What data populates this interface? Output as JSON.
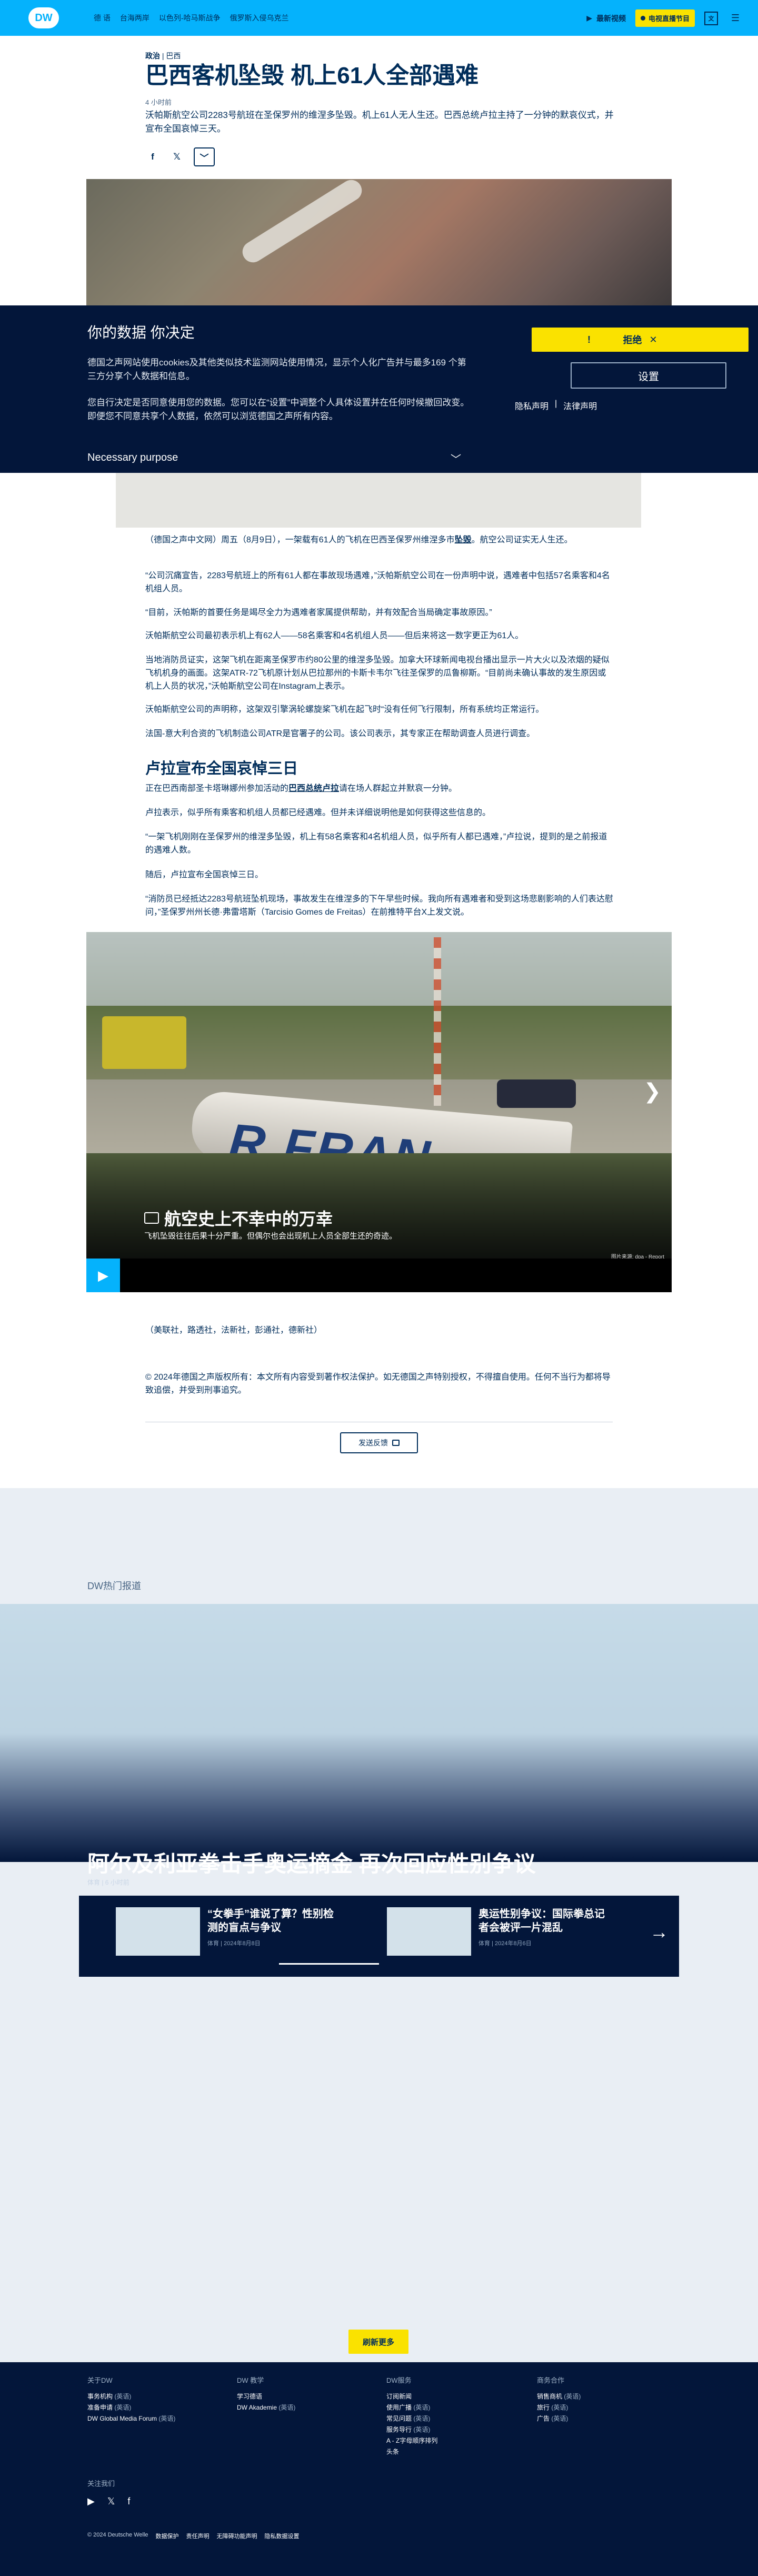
{
  "header": {
    "logo_text": "DW",
    "nav": [
      "德 语",
      "台海两岸",
      "以色列-哈马斯战争",
      "俄罗斯入侵乌克兰"
    ],
    "latest_label": "最新视频",
    "live_label": "电视直播节目",
    "lang_label": "文"
  },
  "article": {
    "kicker_section": "政治",
    "kicker_place": "巴西",
    "title": "巴西客机坠毁 机上61人全部遇难",
    "timestamp": "4 小时前",
    "lead": "沃帕斯航空公司2283号航班在圣保罗州的维涅多坠毁。机上61人无人生还。巴西总统卢拉主持了一分钟的默哀仪式，并宣布全国哀悼三天。",
    "paragraphs": [
      "（德国之声中文网）周五（8月9日），一架载有61人的飞机在巴西圣保罗州维涅多市坠毁。航空公司证实无人生还。",
      "“公司沉痛宣告，2283号航班上的所有61人都在事故现场遇难，”沃帕斯航空公司在一份声明中说，遇难者中包括57名乘客和4名机组人员。",
      "“目前，沃帕斯的首要任务是竭尽全力为遇难者家属提供帮助，并有效配合当局确定事故原因。”",
      "沃帕斯航空公司最初表示机上有62人——58名乘客和4名机组人员——但后来将这一数字更正为61人。",
      "当地消防员证实，这架飞机在距离圣保罗市约80公里的维涅多坠毁。加拿大环球新闻电视台播出显示一片大火以及浓烟的疑似飞机机身的画面。这架ATR-72飞机原计划从巴拉那州的卡斯卡韦尔飞往圣保罗的瓜鲁柳斯。“目前尚未确认事故的发生原因或机上人员的状况，”沃帕斯航空公司在Instagram上表示。",
      "沃帕斯航空公司的声明称，这架双引擎涡轮螺旋桨飞机在起飞时“没有任何飞行限制，所有系统均正常运行。",
      "法国-意大利合资的飞机制造公司ATR是官署子的公司。该公司表示，其专家正在帮助调查人员进行调查。",
      "正在巴西南部圣卡塔琳娜州参加活动的巴西总统卢拉请在场人群起立并默哀一分钟。",
      "卢拉表示，似乎所有乘客和机组人员都已经遇难。但并未详细说明他是如何获得这些信息的。",
      "“一架飞机刚刚在圣保罗州的维涅多坠毁，机上有58名乘客和4名机组人员，似乎所有人都已遇难，”卢拉说，提到的是之前报道的遇难人数。",
      "随后，卢拉宣布全国哀悼三日。",
      "“消防员已经抵达2283号航班坠机现场，事故发生在维涅多的下午早些时候。我向所有遇难者和受到这场悲剧影响的人们表达慰问，”圣保罗州州长德·弗雷塔斯（Tarcisio Gomes de Freitas）在前推特平台X上发文说。"
    ],
    "link_crash": "坠毁",
    "link_lula": "巴西总统卢拉",
    "subheading": "卢拉宣布全国哀悼三日",
    "share": [
      "f",
      "𝕏",
      "﹀"
    ]
  },
  "cookie": {
    "title": "你的数据 你决定",
    "text1": "德国之声网站使用cookies及其他类似技术监测网站使用情况，显示个人化广告并与最多169 个第三方分享个人数据和信息。",
    "text2": "您自行决定是否同意使用您的数据。您可以在“设置”中调整个人具体设置并在任何时候撤回改变。即便您不同意共享个人数据，依然可以浏览德国之声所有内容。",
    "purpose": "Necessary purpose",
    "reject_label": "拒绝",
    "settings_label": "设置",
    "links": [
      "隐私声明",
      "法律声明"
    ]
  },
  "gallery": {
    "fuselage_text": "R FRAN",
    "title": "航空史上不幸中的万幸",
    "subtitle": "飞机坠毁往往后果十分严重。但偶尔也会出现机上人员全部生还的奇迹。",
    "credit": "图片来源: dpa - Report"
  },
  "footer_article": {
    "sources": "（美联社，路透社，法新社，彭通社，德新社）",
    "copyright": "© 2024年德国之声版权所有：本文所有内容受到著作权法保护。如无德国之声特别授权，不得擅自使用。任何不当行为都将导致追偿，并受到刑事追究。",
    "feedback": "发送反馈"
  },
  "trending": {
    "label": "DW热门报道",
    "title": "阿尔及利亚拳击手奥运摘金 再次回应性别争议",
    "meta": "体育 | 6 小时前",
    "cards": [
      {
        "title": "“女拳手”谁说了算？性别检测的盲点与争议",
        "meta": "体育 | 2024年8月8日"
      },
      {
        "title": "奥运性别争议：国际拳总记者会被评一片混乱",
        "meta": "体育 | 2024年8月6日"
      }
    ],
    "more_label": "刷新更多"
  },
  "footer": {
    "columns": [
      {
        "heading": "关于DW",
        "items": [
          [
            "事务机构",
            "(英语)"
          ],
          [
            "准备申请",
            "(英语)"
          ],
          [
            "DW Global Media Forum",
            "(英语)"
          ]
        ]
      },
      {
        "heading": "DW 教学",
        "items": [
          [
            "学习德语",
            ""
          ],
          [
            "DW Akademie",
            "(英语)"
          ]
        ]
      },
      {
        "heading": "DW服务",
        "items": [
          [
            "订阅新闻",
            ""
          ],
          [
            "使用广播",
            "(英语)"
          ],
          [
            "常见问题",
            "(英语)"
          ],
          [
            "服务导行",
            "(英语)"
          ],
          [
            "A - Z字母顺序排列",
            ""
          ],
          [
            "头条",
            ""
          ]
        ]
      },
      {
        "heading": "商务合作",
        "items": [
          [
            "销售商机",
            "(英语)"
          ],
          [
            "旅行",
            "(英语)"
          ],
          [
            "广告",
            "(英语)"
          ]
        ]
      }
    ],
    "follow_label": "关注我们",
    "bottom": [
      "© 2024 Deutsche Welle",
      "数据保护",
      "责任声明",
      "无障碍功能声明",
      "隐私数据设置"
    ]
  },
  "colors": {
    "brand_blue": "#05b2fc",
    "navy": "#002d5a",
    "yellow": "#fae200",
    "dark": "#03163a"
  }
}
